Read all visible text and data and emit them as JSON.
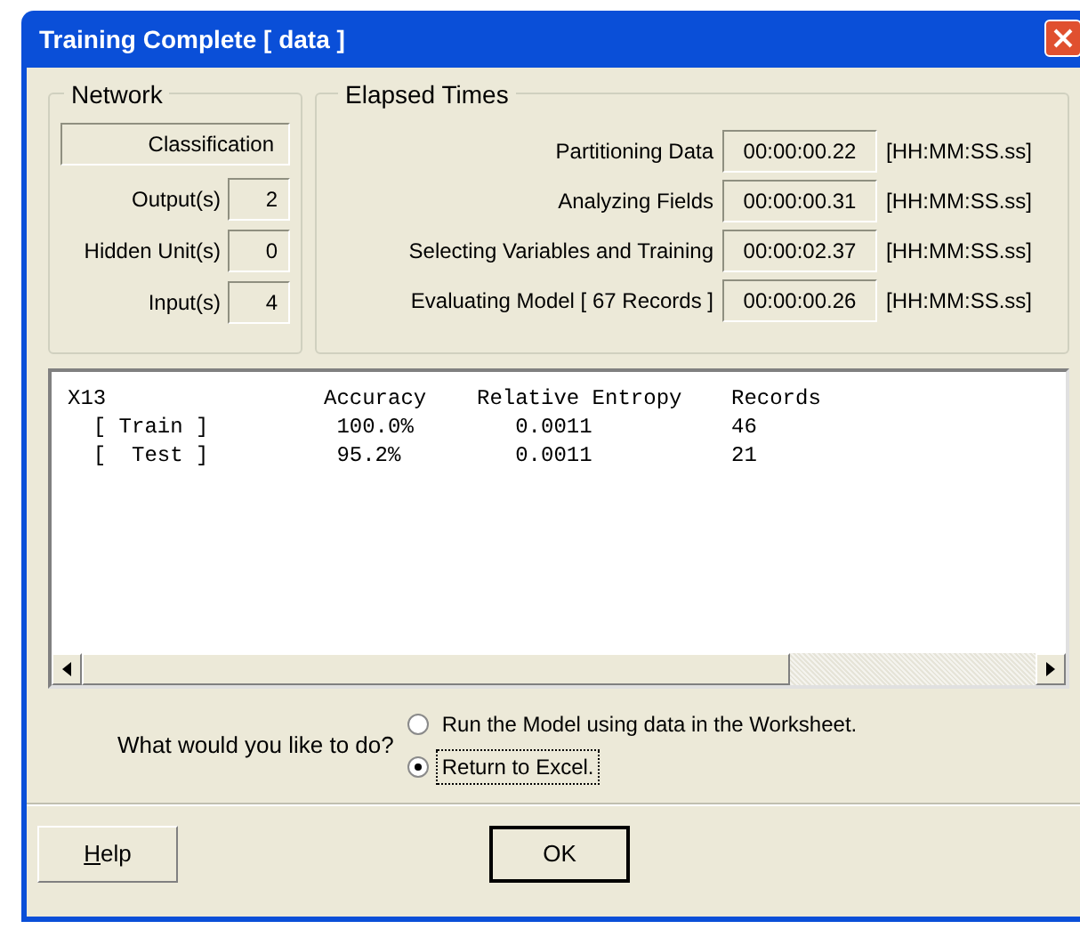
{
  "window": {
    "title": "Training Complete [ data ]"
  },
  "network": {
    "title": "Network",
    "type": "Classification",
    "fields": [
      {
        "label": "Output(s)",
        "value": "2"
      },
      {
        "label": "Hidden Unit(s)",
        "value": "0"
      },
      {
        "label": "Input(s)",
        "value": "4"
      }
    ]
  },
  "elapsed_times": {
    "title": "Elapsed Times",
    "rows": [
      {
        "label": "Partitioning Data",
        "value": "00:00:00.22",
        "unit": "[HH:MM:SS.ss]"
      },
      {
        "label": "Analyzing Fields",
        "value": "00:00:00.31",
        "unit": "[HH:MM:SS.ss]"
      },
      {
        "label": "Selecting Variables and Training",
        "value": "00:00:02.37",
        "unit": "[HH:MM:SS.ss]"
      },
      {
        "label": "Evaluating Model [ 67 Records ]",
        "value": "00:00:00.26",
        "unit": "[HH:MM:SS.ss]"
      }
    ]
  },
  "results": {
    "columns": [
      "X13",
      "Accuracy",
      "Relative Entropy",
      "Records"
    ],
    "rows": [
      [
        "  [ Train ]",
        " 100.0%",
        "   0.0011",
        "46"
      ],
      [
        "  [  Test ]",
        " 95.2%",
        "   0.0011",
        "21"
      ]
    ]
  },
  "prompt": "What would you like to do?",
  "options": [
    {
      "label": "Run the Model using data in the Worksheet.",
      "selected": false
    },
    {
      "label": "Return to Excel.",
      "selected": true
    }
  ],
  "buttons": [
    {
      "label": "Help",
      "default": false
    },
    {
      "label": "OK",
      "default": true
    }
  ]
}
